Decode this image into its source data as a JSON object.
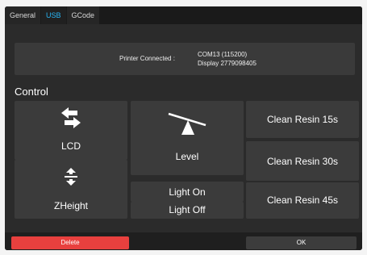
{
  "tabs": [
    {
      "label": "General",
      "active": false
    },
    {
      "label": "USB",
      "active": true
    },
    {
      "label": "GCode",
      "active": false
    }
  ],
  "status": {
    "label": "Printer Connected :",
    "port": "COM13 (115200)",
    "display": "Display 2779098405"
  },
  "control": {
    "title": "Control",
    "lcd": {
      "label": "LCD",
      "icon": "swap-arrows-icon"
    },
    "zheight": {
      "label": "ZHeight",
      "icon": "z-height-icon"
    },
    "level": {
      "label": "Level",
      "icon": "level-icon"
    },
    "light_on": {
      "label": "Light On"
    },
    "light_off": {
      "label": "Light Off"
    },
    "clean_15": {
      "label": "Clean Resin 15s"
    },
    "clean_30": {
      "label": "Clean Resin 30s"
    },
    "clean_45": {
      "label": "Clean Resin 45s"
    }
  },
  "footer": {
    "delete_label": "Delete",
    "ok_label": "OK"
  },
  "colors": {
    "accent": "#29b6f6",
    "danger": "#e8403e",
    "panel": "#2b2b2b",
    "button": "#3b3b3b"
  }
}
